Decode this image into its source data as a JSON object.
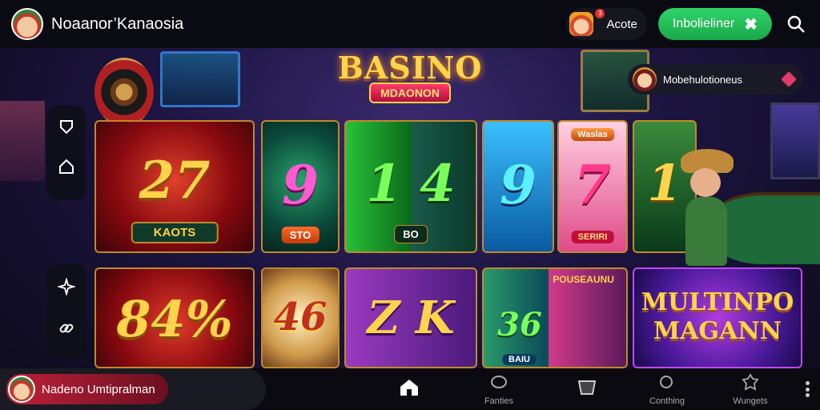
{
  "header": {
    "app_title": "Noaanor’Kanaosia",
    "notification_label": "Acote",
    "notification_count": "3",
    "cta_label": "Inbolieliner"
  },
  "hero": {
    "logo_title": "BASINO",
    "logo_ribbon": "MDAONON",
    "promo_label": "Mobehulotioneus"
  },
  "games": [
    {
      "number": "27",
      "tag": "KAOTS"
    },
    {
      "number": "9",
      "tag": "STO"
    },
    {
      "number": "1 4",
      "tag": "BO"
    },
    {
      "number": "9",
      "tag": ""
    },
    {
      "number": "7",
      "tag": "SERIRI",
      "top_tag": "Waslas"
    },
    {
      "number": "1",
      "tag": ""
    },
    {
      "number": "84%",
      "tag": ""
    },
    {
      "number": "46",
      "tag": ""
    },
    {
      "number": "Z K",
      "tag": ""
    },
    {
      "number": "36",
      "tag": "BAIU",
      "top_tag": "POUSEAUNU"
    },
    {
      "title_line1": "MULTINPO",
      "title_line2": "MAGANN"
    }
  ],
  "user": {
    "name": "Nadeno Umtipralman"
  },
  "nav": [
    {
      "label": "",
      "icon": "home-icon"
    },
    {
      "label": "Fanties",
      "icon": "chat-icon"
    },
    {
      "label": "",
      "icon": "cup-icon"
    },
    {
      "label": "Conthing",
      "icon": "search-icon"
    },
    {
      "label": "Wungets",
      "icon": "badge-icon"
    }
  ],
  "colors": {
    "accent_green": "#1fbf55",
    "gold": "#ffd34a",
    "background": "#0c0a18"
  }
}
